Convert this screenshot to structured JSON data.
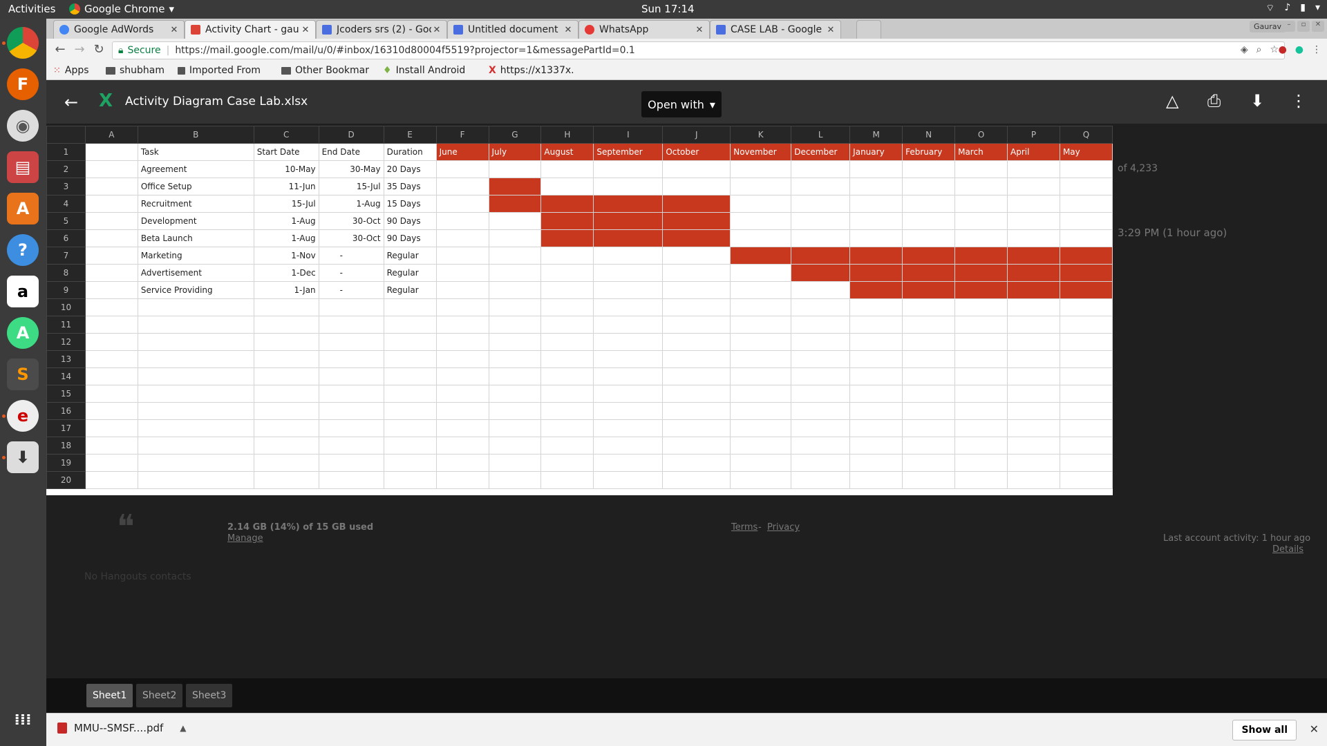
{
  "topbar": {
    "activities": "Activities",
    "app_name": "Google Chrome",
    "clock": "Sun 17:14"
  },
  "tabs": [
    {
      "label": "Google AdWords",
      "color": "#4285f4"
    },
    {
      "label": "Activity Chart - gau",
      "color": "#db4437"
    },
    {
      "label": "Jcoders srs (2) - Goo",
      "color": "#4a6ee0"
    },
    {
      "label": "Untitled document",
      "color": "#4a6ee0"
    },
    {
      "label": "WhatsApp",
      "color": "#e53935"
    },
    {
      "label": "CASE LAB - Google",
      "color": "#4a6ee0"
    }
  ],
  "profile": "Gaurav",
  "omnibox": {
    "secure": "Secure",
    "url": "https://mail.google.com/mail/u/0/#inbox/16310d80004f5519?projector=1&messagePartId=0.1"
  },
  "bookmarks": [
    {
      "label": "Apps"
    },
    {
      "label": "shubham"
    },
    {
      "label": "Imported From"
    },
    {
      "label": "Other Bookmar"
    },
    {
      "label": "Install Android"
    },
    {
      "label": "https://x1337x."
    }
  ],
  "viewer": {
    "file_name": "Activity Diagram Case Lab.xlsx",
    "open_with": "Open with"
  },
  "background": {
    "count": "of 4,233",
    "time": "3:29 PM (1 hour ago)",
    "storage": "2.14 GB (14%) of 15 GB used",
    "manage": "Manage",
    "terms": "Terms",
    "dash": " - ",
    "privacy": "Privacy",
    "last_activity": "Last account activity: 1 hour ago",
    "details": "Details",
    "hangouts": "No Hangouts contacts"
  },
  "sheet": {
    "columns": [
      "A",
      "B",
      "C",
      "D",
      "E",
      "F",
      "G",
      "H",
      "I",
      "J",
      "K",
      "L",
      "M",
      "N",
      "O",
      "P",
      "Q"
    ],
    "headers": {
      "task": "Task",
      "start": "Start Date",
      "end": "End Date",
      "duration": "Duration"
    },
    "months": [
      "June",
      "July",
      "August",
      "September",
      "October",
      "November",
      "December",
      "January",
      "February",
      "March",
      "April",
      "May"
    ],
    "rows": [
      {
        "task": "Agreement",
        "start": "10-May",
        "end": "30-May",
        "duration": "20 Days",
        "from": -1,
        "to": -1
      },
      {
        "task": "Office Setup",
        "start": "11-Jun",
        "end": "15-Jul",
        "duration": "35 Days",
        "from": 1,
        "to": 1
      },
      {
        "task": "Recruitment",
        "start": "15-Jul",
        "end": "1-Aug",
        "duration": "15 Days",
        "from": 1,
        "to": 4
      },
      {
        "task": "Development",
        "start": "1-Aug",
        "end": "30-Oct",
        "duration": " 90 Days",
        "from": 2,
        "to": 4
      },
      {
        "task": "Beta Launch",
        "start": "1-Aug",
        "end": "30-Oct",
        "duration": "90 Days",
        "from": 2,
        "to": 4
      },
      {
        "task": "Marketing",
        "start": "1-Nov",
        "end": "-",
        "duration": "Regular",
        "from": 5,
        "to": 11
      },
      {
        "task": "Advertisement",
        "start": "1-Dec",
        "end": "-",
        "duration": "Regular",
        "from": 6,
        "to": 11
      },
      {
        "task": "Service Providing",
        "start": "1-Jan",
        "end": "-",
        "duration": "Regular",
        "from": 7,
        "to": 11
      }
    ],
    "total_rows": 20,
    "bar_color": "#c8381f"
  },
  "sheet_tabs": [
    "Sheet1",
    "Sheet2",
    "Sheet3"
  ],
  "downloads": {
    "file": "MMU--SMSF....pdf",
    "show_all": "Show all"
  }
}
